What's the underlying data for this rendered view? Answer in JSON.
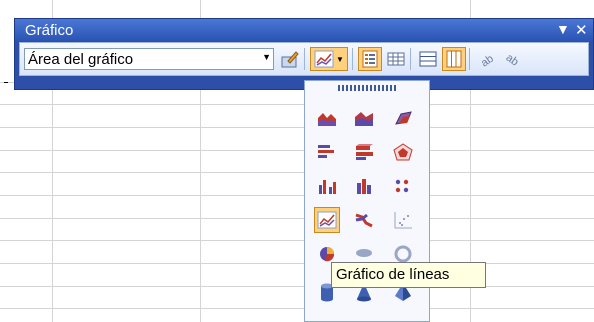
{
  "toolbar": {
    "title": "Gráfico",
    "chart_objects_selected": "Área del gráfico"
  },
  "tooltip": {
    "text": "Gráfico de líneas"
  }
}
